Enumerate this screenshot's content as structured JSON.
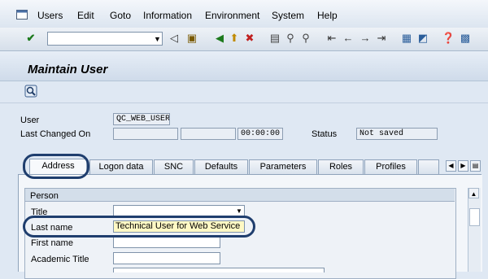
{
  "menu": [
    {
      "label": "Users",
      "name": "menu-users"
    },
    {
      "label": "Edit",
      "name": "menu-edit"
    },
    {
      "label": "Goto",
      "name": "menu-goto"
    },
    {
      "label": "Information",
      "name": "menu-information"
    },
    {
      "label": "Environment",
      "name": "menu-environment"
    },
    {
      "label": "System",
      "name": "menu-system"
    },
    {
      "label": "Help",
      "name": "menu-help"
    }
  ],
  "toolbar": {
    "icons": [
      "enter-icon",
      "back-icon",
      "save-icon",
      "back-arrow-icon",
      "exit-icon",
      "cancel-icon",
      "print-icon",
      "find-icon",
      "find-next-icon",
      "first-page-icon",
      "previous-page-icon",
      "next-page-icon",
      "last-page-icon",
      "create-session-icon",
      "shortcut-icon",
      "help-icon",
      "layout-menu-icon"
    ],
    "command_value": ""
  },
  "title": "Maintain User",
  "app_toolbar": {
    "icons": [
      "other-user-icon"
    ]
  },
  "header": {
    "user_label": "User",
    "user_value": "QC_WEB_USER",
    "changed_label": "Last Changed On",
    "changed_by": "",
    "changed_date": "",
    "changed_time": "00:00:00",
    "status_label": "Status",
    "status_value": "Not saved"
  },
  "tabs": [
    {
      "label": "Address",
      "active": true
    },
    {
      "label": "Logon data"
    },
    {
      "label": "SNC"
    },
    {
      "label": "Defaults"
    },
    {
      "label": "Parameters"
    },
    {
      "label": "Roles"
    },
    {
      "label": "Profiles"
    }
  ],
  "person": {
    "group_title": "Person",
    "title_label": "Title",
    "title_value": "",
    "lastname_label": "Last name",
    "lastname_value": "Technical User for Web Service",
    "firstname_label": "First name",
    "firstname_value": "",
    "academic_label": "Academic Title",
    "academic_value": ""
  },
  "colors": {
    "highlight": "#1f3e6e",
    "background": "#dfe8f3",
    "input_highlight": "#fff9c4"
  }
}
